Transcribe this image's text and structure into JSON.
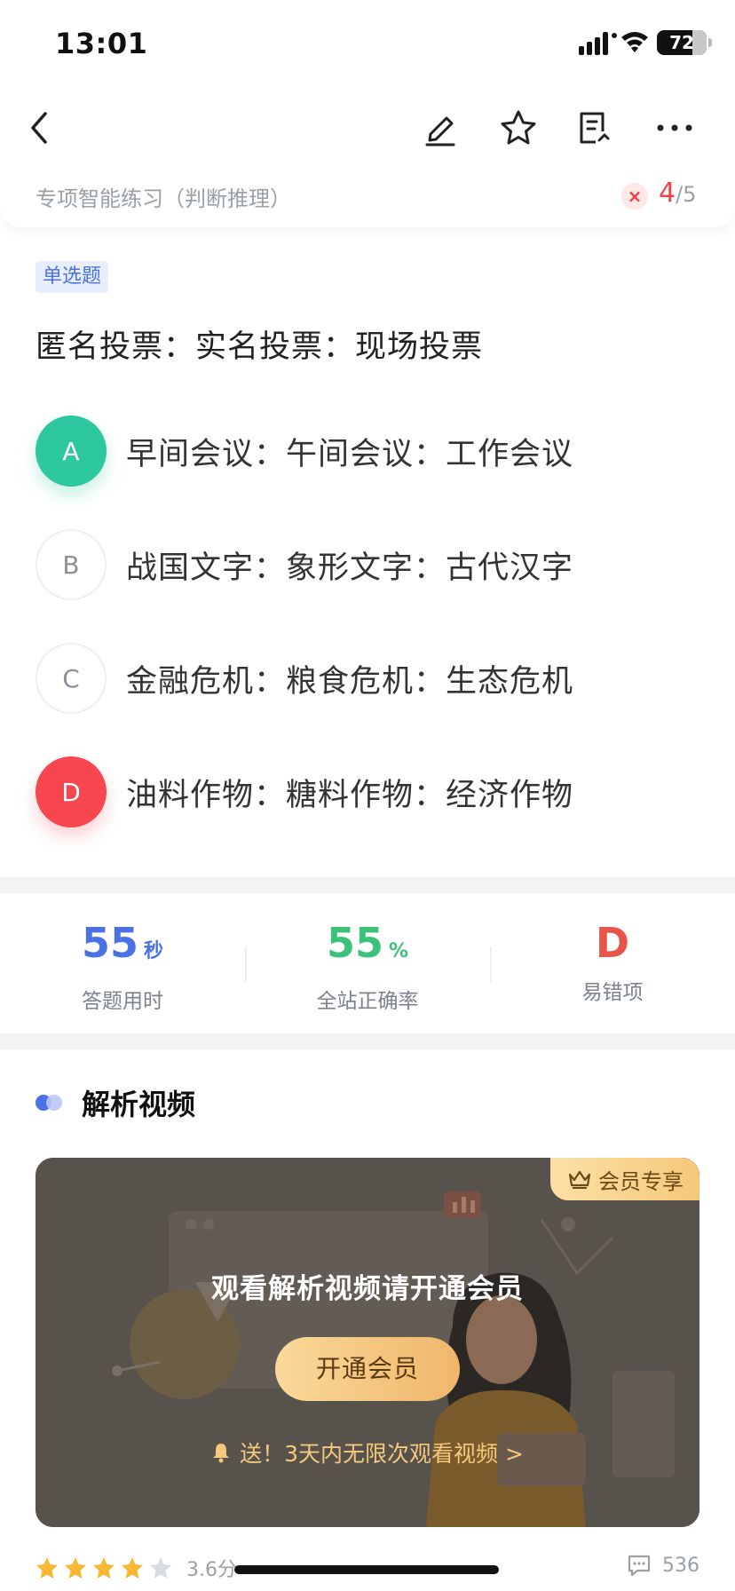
{
  "status_bar": {
    "time": "13:01",
    "battery": "72"
  },
  "toolbar": {
    "icons": [
      "back-icon",
      "edit-icon",
      "star-icon",
      "notes-icon",
      "more-icon"
    ]
  },
  "header": {
    "title": "专项智能练习（判断推理）",
    "current": "4",
    "total": "/5",
    "wrong_mark": "×"
  },
  "question": {
    "type_badge": "单选题",
    "stem": "匿名投票：实名投票：现场投票",
    "options": [
      {
        "letter": "A",
        "text": "早间会议：午间会议：工作会议",
        "state": "correct"
      },
      {
        "letter": "B",
        "text": "战国文字：象形文字：古代汉字",
        "state": "normal"
      },
      {
        "letter": "C",
        "text": "金融危机：粮食危机：生态危机",
        "state": "normal"
      },
      {
        "letter": "D",
        "text": "油料作物：糖料作物：经济作物",
        "state": "wrong"
      }
    ]
  },
  "stats": {
    "time_value": "55",
    "time_unit": "秒",
    "time_label": "答题用时",
    "accuracy_value": "55",
    "accuracy_unit": "%",
    "accuracy_label": "全站正确率",
    "error_value": "D",
    "error_label": "易错项"
  },
  "video_section": {
    "title": "解析视频",
    "vip_tag": "会员专享",
    "message": "观看解析视频请开通会员",
    "button": "开通会员",
    "promo": "送！3天内无限次观看视频 >"
  },
  "rating": {
    "stars_filled": 4,
    "stars_total": 5,
    "score": "3.6分",
    "comments": "536"
  },
  "colors": {
    "accent": "#4a72e6",
    "correct": "#2dc7a0",
    "wrong": "#f6464e",
    "gold": "#f6c87a"
  }
}
